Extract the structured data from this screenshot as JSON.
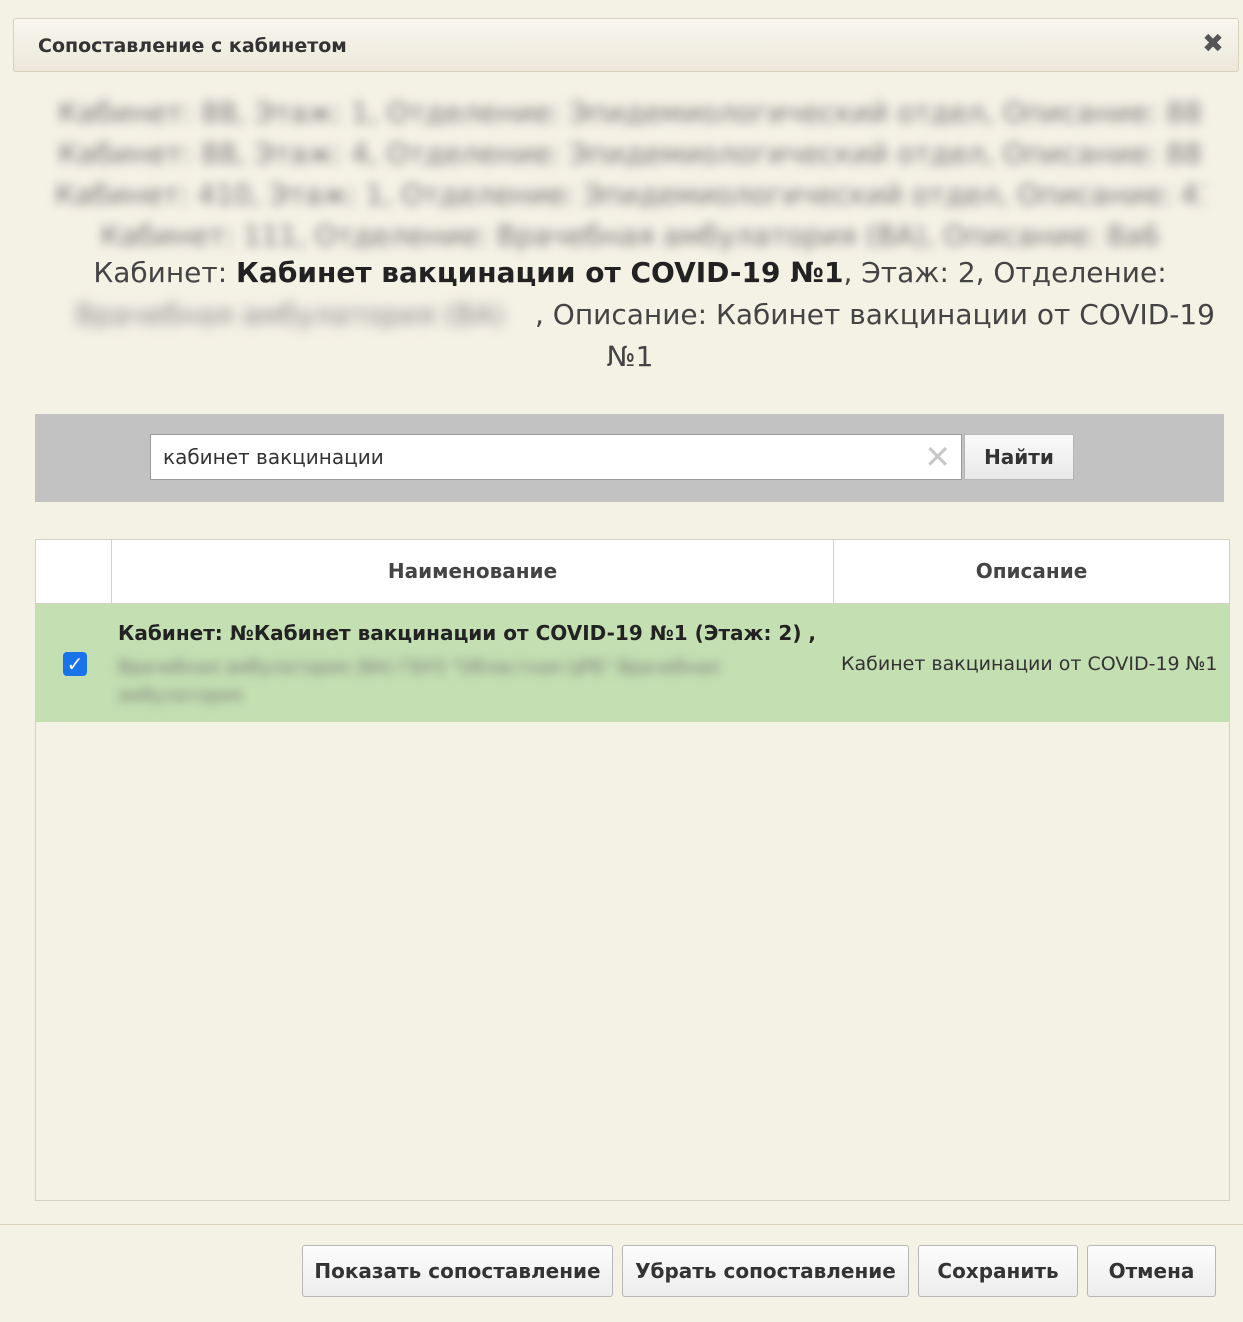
{
  "dialog": {
    "title": "Сопоставление с кабинетом",
    "close_icon": "close-icon"
  },
  "blurred_list": [
    "Кабинет: 88, Этаж: 1, Отделение: Эпидемиологический отдел, Описание: 88",
    "Кабинет: 88, Этаж: 4, Отделение: Эпидемиологический отдел, Описание: 88",
    "Кабинет: 410, Этаж: 1, Отделение: Эпидемиологический отдел, Описание: 410",
    "Кабинет: 111, Отделение: Врачебная амбулатория (ВА), Описание: 8а6"
  ],
  "summary": {
    "cabinet_label": "Кабинет: ",
    "cabinet_name": "Кабинет вакцинации от COVID-19 №1",
    "floor_part": ", Этаж: 2, Отделение:",
    "department_blurred": "Врачебная амбулатория (ВА)",
    "description_part": ", Описание: Кабинет вакцинации от COVID-19 №1"
  },
  "search": {
    "value": "кабинет вакцинации",
    "find_label": "Найти"
  },
  "grid": {
    "columns": [
      "Наименование",
      "Описание"
    ],
    "rows": [
      {
        "checked": true,
        "name": "Кабинет: №Кабинет вакцинации от COVID-19 №1 (Этаж: 2) ,",
        "name_blurred": "Врачебная амбулатория (ВА) ГБУЗ \"Областная ЦРБ\" Врачебная амбулатория",
        "description": "Кабинет вакцинации от COVID-19 №1"
      }
    ]
  },
  "footer": {
    "show_mapping": "Показать сопоставление",
    "remove_mapping": "Убрать сопоставление",
    "save": "Сохранить",
    "cancel": "Отмена"
  },
  "colors": {
    "background": "#f4f1e5",
    "selected_row": "#c4dfb2",
    "search_panel": "#c2c2c2",
    "checkbox": "#1a73e8"
  }
}
